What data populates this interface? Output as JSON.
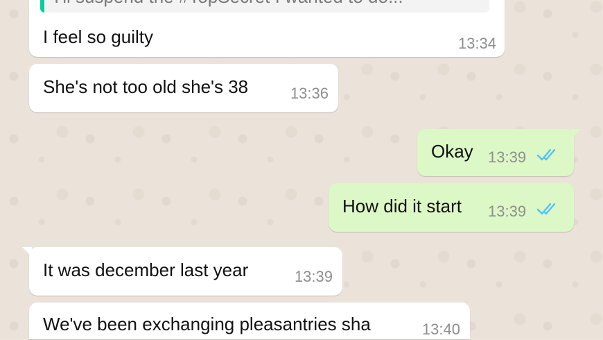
{
  "messages": [
    {
      "direction": "incoming",
      "quoted_preview": "I'll suspend the #TopSecret I wanted to do...",
      "text": "I feel so guilty",
      "time": "13:34"
    },
    {
      "direction": "incoming",
      "text": "She's not too old she's 38",
      "time": "13:36"
    },
    {
      "direction": "outgoing",
      "text": "Okay",
      "time": "13:39",
      "status": "read"
    },
    {
      "direction": "outgoing",
      "text": "How did it start",
      "time": "13:39",
      "status": "read"
    },
    {
      "direction": "incoming",
      "text": "It was december last year",
      "time": "13:39"
    },
    {
      "direction": "incoming",
      "text": "We've been exchanging pleasantries sha",
      "time": "13:40"
    }
  ],
  "colors": {
    "incoming_bubble": "#ffffff",
    "outgoing_bubble": "#dcf8c6",
    "read_ticks": "#4fc3f7",
    "quote_bar": "#06cf9c",
    "wallpaper": "#ebe3d9"
  },
  "icons": {
    "read_receipt": "double-check-icon"
  }
}
